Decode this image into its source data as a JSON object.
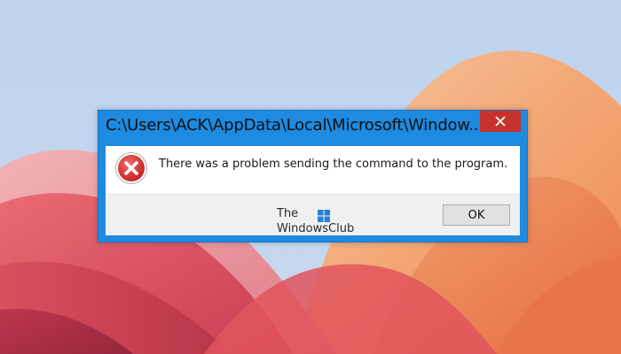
{
  "dialog": {
    "title": "C:\\Users\\ACK\\AppData\\Local\\Microsoft\\Window...",
    "message": "There was a problem sending the command to the program.",
    "ok_label": "OK",
    "icon": "error-icon",
    "close_icon": "close-icon"
  },
  "watermark": {
    "line1": "The",
    "line2": "WindowsClub"
  },
  "colors": {
    "titlebar": "#1e8ae0",
    "close_button": "#c7332c",
    "error_icon": "#cf2a27",
    "button_area": "#f0f0f0"
  }
}
